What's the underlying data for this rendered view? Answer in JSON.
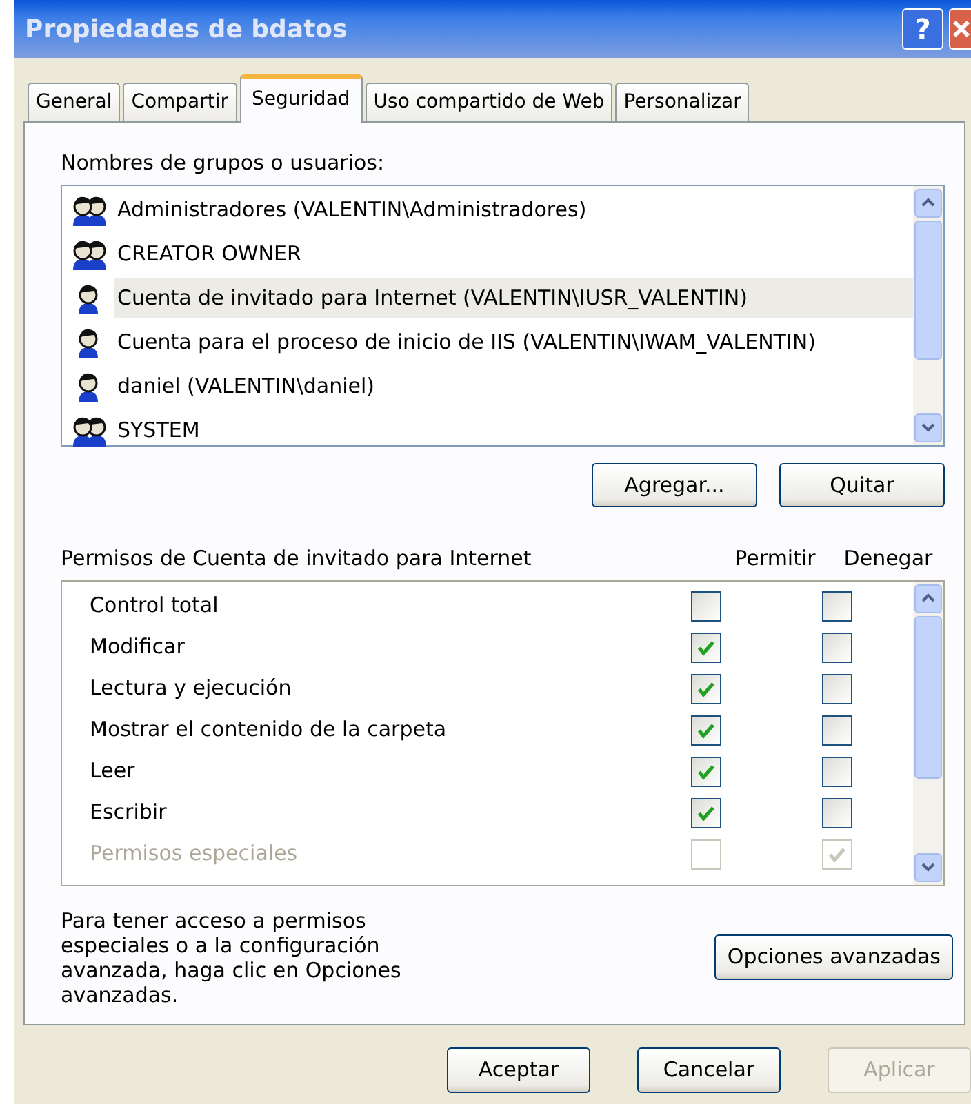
{
  "window": {
    "title": "Propiedades de bdatos",
    "help": "?"
  },
  "tabs": [
    {
      "label": "General",
      "selected": false
    },
    {
      "label": "Compartir",
      "selected": false
    },
    {
      "label": "Seguridad",
      "selected": true
    },
    {
      "label": "Uso compartido de Web",
      "selected": false
    },
    {
      "label": "Personalizar",
      "selected": false
    }
  ],
  "users_label": "Nombres de grupos o usuarios:",
  "users": [
    {
      "name": "Administradores (VALENTIN\\Administradores)",
      "kind": "group",
      "selected": false
    },
    {
      "name": "CREATOR OWNER",
      "kind": "group",
      "selected": false
    },
    {
      "name": "Cuenta de invitado para Internet (VALENTIN\\IUSR_VALENTIN)",
      "kind": "user",
      "selected": true
    },
    {
      "name": "Cuenta para el proceso de inicio de IIS (VALENTIN\\IWAM_VALENTIN)",
      "kind": "user",
      "selected": false
    },
    {
      "name": "daniel (VALENTIN\\daniel)",
      "kind": "user",
      "selected": false
    },
    {
      "name": "SYSTEM",
      "kind": "group",
      "selected": false
    }
  ],
  "user_buttons": [
    "Agregar...",
    "Quitar"
  ],
  "permissions": {
    "title": "Permisos de Cuenta de invitado para Internet",
    "columns": [
      "Permitir",
      "Denegar"
    ],
    "rows": [
      {
        "label": "Control total",
        "allow": false,
        "deny": false,
        "disabled": false
      },
      {
        "label": "Modificar",
        "allow": true,
        "deny": false,
        "disabled": false
      },
      {
        "label": "Lectura y ejecución",
        "allow": true,
        "deny": false,
        "disabled": false
      },
      {
        "label": "Mostrar el contenido de la carpeta",
        "allow": true,
        "deny": false,
        "disabled": false
      },
      {
        "label": "Leer",
        "allow": true,
        "deny": false,
        "disabled": false
      },
      {
        "label": "Escribir",
        "allow": true,
        "deny": false,
        "disabled": false
      },
      {
        "label": "Permisos especiales",
        "allow": false,
        "deny": true,
        "disabled": true
      }
    ]
  },
  "advanced": {
    "text": "Para tener acceso a permisos especiales o a la configuración avanzada, haga clic en Opciones avanzadas.",
    "button": "Opciones avanzadas"
  },
  "buttons": [
    {
      "label": "Aceptar",
      "disabled": false
    },
    {
      "label": "Cancelar",
      "disabled": false
    },
    {
      "label": "Aplicar",
      "disabled": true
    }
  ]
}
